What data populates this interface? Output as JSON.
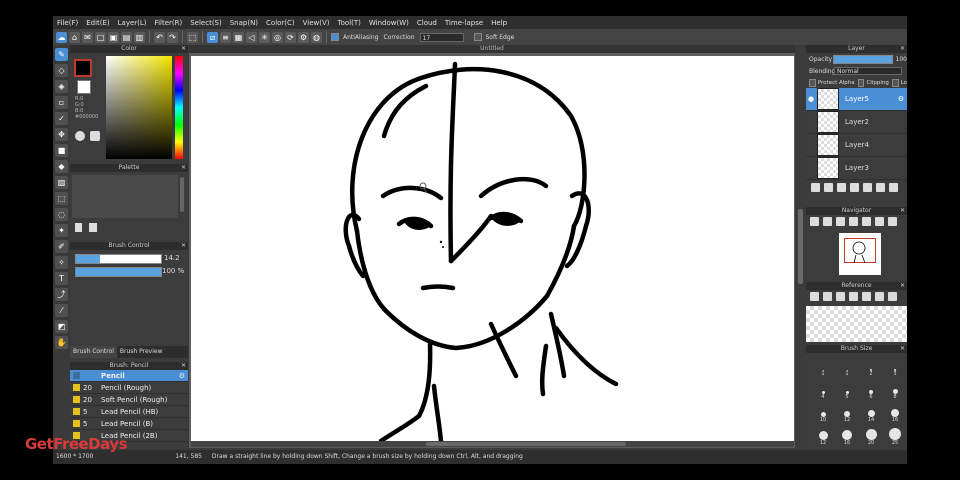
{
  "menu": [
    "File(F)",
    "Edit(E)",
    "Layer(L)",
    "Filter(R)",
    "Select(S)",
    "Snap(N)",
    "Color(C)",
    "View(V)",
    "Tool(T)",
    "Window(W)",
    "Cloud",
    "Time-lapse",
    "Help"
  ],
  "toolbar": {
    "antialiasing_label": "AntiAliasing",
    "correction_label": "Correction",
    "correction_value": "17",
    "soft_edge_label": "Soft Edge"
  },
  "color_panel": {
    "title": "Color",
    "readout": [
      "R:0",
      "G:0",
      "B:0"
    ],
    "hex": "#000000",
    "colors": {
      "fg": "#000000",
      "bg": "#ffffff",
      "accent": "#4a8fd6"
    }
  },
  "palette_panel": {
    "title": "Palette"
  },
  "brush_control": {
    "title": "Brush Control",
    "size_value": "14.2",
    "opacity_value": "100 %",
    "tab_control": "Brush Control",
    "tab_preview": "Brush Preview"
  },
  "brush_list": {
    "title": "Brush: Pencil",
    "items": [
      {
        "size": "",
        "name": "Pencil"
      },
      {
        "size": "20",
        "name": "Pencil (Rough)"
      },
      {
        "size": "20",
        "name": "Soft Pencil (Rough)"
      },
      {
        "size": "5",
        "name": "Lead Pencil (HB)"
      },
      {
        "size": "5",
        "name": "Lead Pencil (B)"
      },
      {
        "size": "",
        "name": "Lead Pencil (2B)"
      }
    ]
  },
  "canvas": {
    "tab_title": "Untitled"
  },
  "layer_panel": {
    "title": "Layer",
    "opacity_label": "Opacity",
    "opacity_value": "100",
    "blending_label": "Blending",
    "blending_value": "Normal",
    "protect_alpha": "Protect Alpha",
    "clipping": "Clipping",
    "lock": "Lo",
    "layers": [
      "Layer5",
      "Layer2",
      "Layer4",
      "Layer3"
    ]
  },
  "navigator": {
    "title": "Navigator"
  },
  "reference": {
    "title": "Reference"
  },
  "brush_size": {
    "title": "Brush Size",
    "rows": [
      [
        "1",
        "1",
        "2",
        "3"
      ],
      [
        "4",
        "5",
        "6",
        "8"
      ],
      [
        "10",
        "12",
        "14",
        "16"
      ],
      [
        "12",
        "16",
        "20",
        "25"
      ],
      [
        "",
        "",
        "",
        ""
      ]
    ]
  },
  "status": {
    "canvas_size": "1600 * 1700",
    "text": "141, 585",
    "hint": "Draw a straight line by holding down Shift, Change a brush size by holding down Ctrl, Alt, and dragging"
  },
  "watermark": {
    "text": "GetFreeDays"
  }
}
